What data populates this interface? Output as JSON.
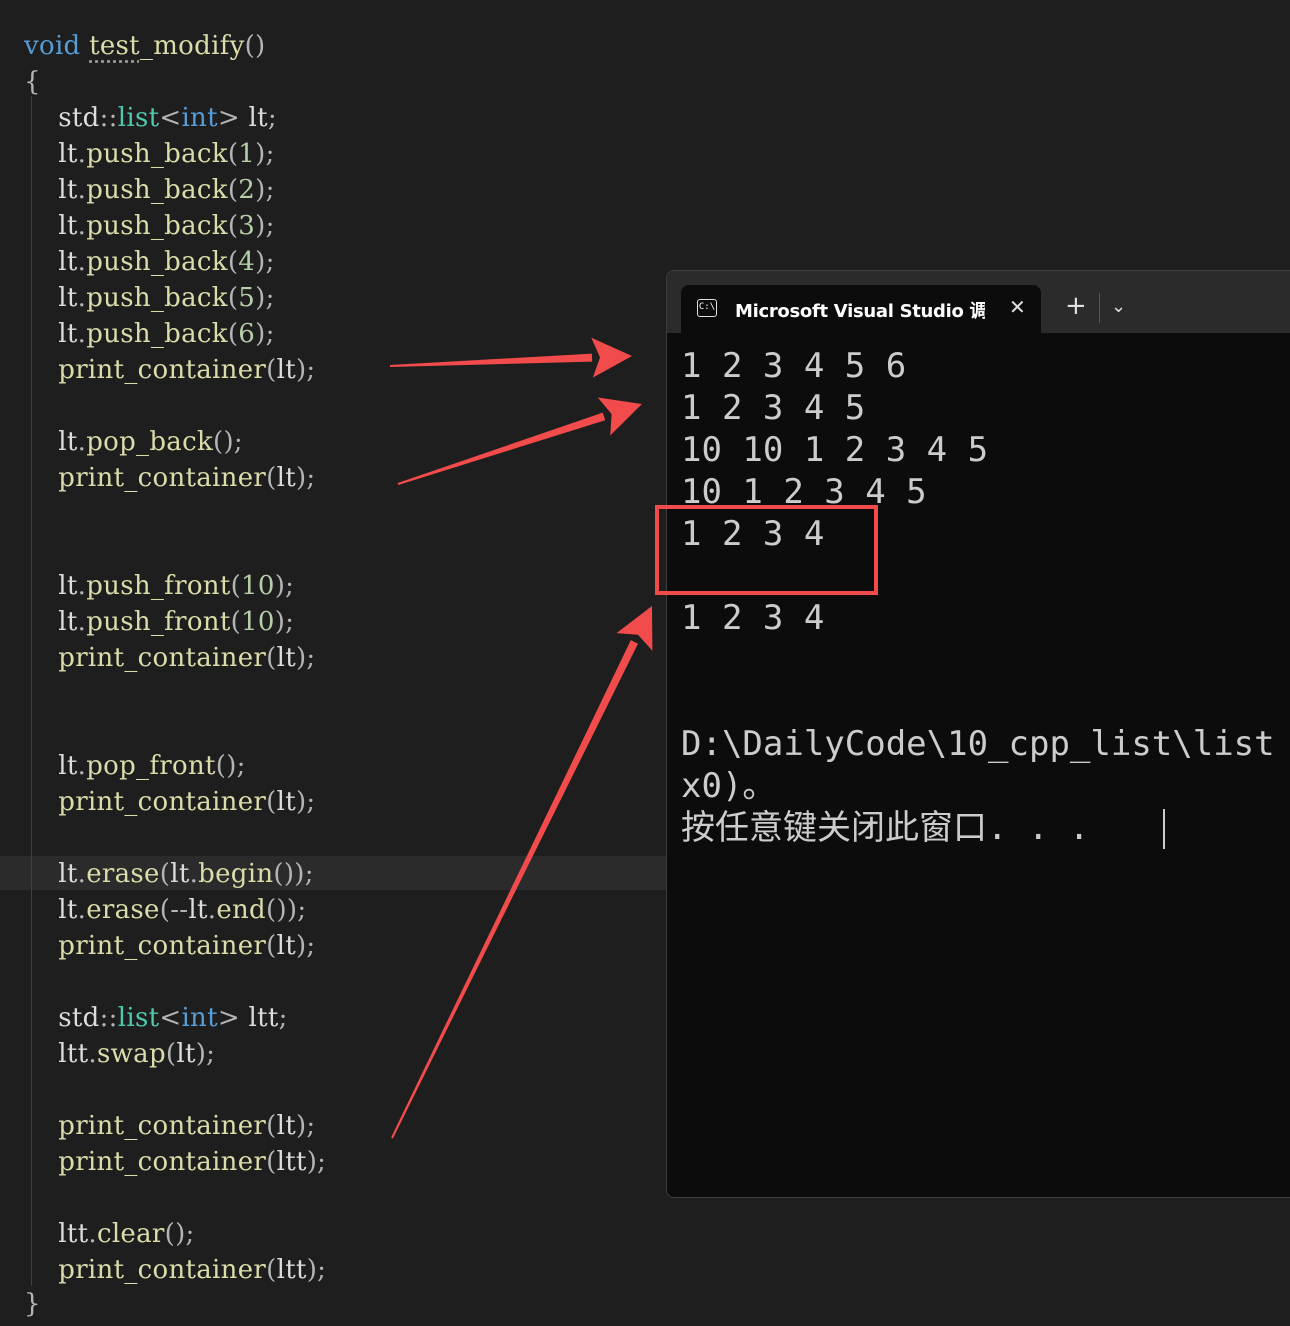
{
  "code": {
    "lines": [
      {
        "t": [
          {
            "c": "kw",
            "v": "void"
          },
          {
            "c": "id",
            "v": " "
          },
          {
            "c": "fn squig",
            "v": "test"
          },
          {
            "c": "fn",
            "v": "_modify"
          },
          {
            "c": "pu",
            "v": "()"
          }
        ]
      },
      {
        "t": [
          {
            "c": "pu",
            "v": "{"
          }
        ]
      },
      {
        "t": [
          {
            "c": "id",
            "v": "    std"
          },
          {
            "c": "pu",
            "v": "::"
          },
          {
            "c": "ty",
            "v": "list"
          },
          {
            "c": "pu",
            "v": "<"
          },
          {
            "c": "kw",
            "v": "int"
          },
          {
            "c": "pu",
            "v": ">"
          },
          {
            "c": "id",
            "v": " lt"
          },
          {
            "c": "pu",
            "v": ";"
          }
        ]
      },
      {
        "t": [
          {
            "c": "id",
            "v": "    lt"
          },
          {
            "c": "pu",
            "v": "."
          },
          {
            "c": "fn",
            "v": "push_back"
          },
          {
            "c": "pu",
            "v": "("
          },
          {
            "c": "nu",
            "v": "1"
          },
          {
            "c": "pu",
            "v": ");"
          }
        ]
      },
      {
        "t": [
          {
            "c": "id",
            "v": "    lt"
          },
          {
            "c": "pu",
            "v": "."
          },
          {
            "c": "fn",
            "v": "push_back"
          },
          {
            "c": "pu",
            "v": "("
          },
          {
            "c": "nu",
            "v": "2"
          },
          {
            "c": "pu",
            "v": ");"
          }
        ]
      },
      {
        "t": [
          {
            "c": "id",
            "v": "    lt"
          },
          {
            "c": "pu",
            "v": "."
          },
          {
            "c": "fn",
            "v": "push_back"
          },
          {
            "c": "pu",
            "v": "("
          },
          {
            "c": "nu",
            "v": "3"
          },
          {
            "c": "pu",
            "v": ");"
          }
        ]
      },
      {
        "t": [
          {
            "c": "id",
            "v": "    lt"
          },
          {
            "c": "pu",
            "v": "."
          },
          {
            "c": "fn",
            "v": "push_back"
          },
          {
            "c": "pu",
            "v": "("
          },
          {
            "c": "nu",
            "v": "4"
          },
          {
            "c": "pu",
            "v": ");"
          }
        ]
      },
      {
        "t": [
          {
            "c": "id",
            "v": "    lt"
          },
          {
            "c": "pu",
            "v": "."
          },
          {
            "c": "fn",
            "v": "push_back"
          },
          {
            "c": "pu",
            "v": "("
          },
          {
            "c": "nu",
            "v": "5"
          },
          {
            "c": "pu",
            "v": ");"
          }
        ]
      },
      {
        "t": [
          {
            "c": "id",
            "v": "    lt"
          },
          {
            "c": "pu",
            "v": "."
          },
          {
            "c": "fn",
            "v": "push_back"
          },
          {
            "c": "pu",
            "v": "("
          },
          {
            "c": "nu",
            "v": "6"
          },
          {
            "c": "pu",
            "v": ");"
          }
        ]
      },
      {
        "t": [
          {
            "c": "fn",
            "v": "    print_container"
          },
          {
            "c": "pu",
            "v": "("
          },
          {
            "c": "id",
            "v": "lt"
          },
          {
            "c": "pu",
            "v": ");"
          }
        ]
      },
      {
        "t": [
          {
            "c": "id",
            "v": "    lt"
          },
          {
            "c": "pu",
            "v": "."
          },
          {
            "c": "fn",
            "v": "pop_back"
          },
          {
            "c": "pu",
            "v": "();"
          }
        ]
      },
      {
        "t": [
          {
            "c": "fn",
            "v": "    print_container"
          },
          {
            "c": "pu",
            "v": "("
          },
          {
            "c": "id",
            "v": "lt"
          },
          {
            "c": "pu",
            "v": ");"
          }
        ]
      },
      {
        "t": [
          {
            "c": "id",
            "v": "    lt"
          },
          {
            "c": "pu",
            "v": "."
          },
          {
            "c": "fn",
            "v": "push_front"
          },
          {
            "c": "pu",
            "v": "("
          },
          {
            "c": "nu",
            "v": "10"
          },
          {
            "c": "pu",
            "v": ");"
          }
        ]
      },
      {
        "t": [
          {
            "c": "id",
            "v": "    lt"
          },
          {
            "c": "pu",
            "v": "."
          },
          {
            "c": "fn",
            "v": "push_front"
          },
          {
            "c": "pu",
            "v": "("
          },
          {
            "c": "nu",
            "v": "10"
          },
          {
            "c": "pu",
            "v": ");"
          }
        ]
      },
      {
        "t": [
          {
            "c": "fn",
            "v": "    print_container"
          },
          {
            "c": "pu",
            "v": "("
          },
          {
            "c": "id",
            "v": "lt"
          },
          {
            "c": "pu",
            "v": ");"
          }
        ]
      },
      {
        "t": [
          {
            "c": "id",
            "v": "    lt"
          },
          {
            "c": "pu",
            "v": "."
          },
          {
            "c": "fn",
            "v": "pop_front"
          },
          {
            "c": "pu",
            "v": "();"
          }
        ]
      },
      {
        "t": [
          {
            "c": "fn",
            "v": "    print_container"
          },
          {
            "c": "pu",
            "v": "("
          },
          {
            "c": "id",
            "v": "lt"
          },
          {
            "c": "pu",
            "v": ");"
          }
        ]
      },
      {
        "t": [
          {
            "c": "id",
            "v": "    lt"
          },
          {
            "c": "pu",
            "v": "."
          },
          {
            "c": "fn",
            "v": "erase"
          },
          {
            "c": "pu",
            "v": "("
          },
          {
            "c": "id",
            "v": "lt"
          },
          {
            "c": "pu",
            "v": "."
          },
          {
            "c": "fn",
            "v": "begin"
          },
          {
            "c": "pu",
            "v": "());"
          }
        ]
      },
      {
        "t": [
          {
            "c": "id",
            "v": "    lt"
          },
          {
            "c": "pu",
            "v": "."
          },
          {
            "c": "fn",
            "v": "erase"
          },
          {
            "c": "pu",
            "v": "(--"
          },
          {
            "c": "id",
            "v": "lt"
          },
          {
            "c": "pu",
            "v": "."
          },
          {
            "c": "fn",
            "v": "end"
          },
          {
            "c": "pu",
            "v": "());"
          }
        ]
      },
      {
        "t": [
          {
            "c": "fn",
            "v": "    print_container"
          },
          {
            "c": "pu",
            "v": "("
          },
          {
            "c": "id",
            "v": "lt"
          },
          {
            "c": "pu",
            "v": ");"
          }
        ]
      },
      {
        "t": [
          {
            "c": "id",
            "v": "    std"
          },
          {
            "c": "pu",
            "v": "::"
          },
          {
            "c": "ty",
            "v": "list"
          },
          {
            "c": "pu",
            "v": "<"
          },
          {
            "c": "kw",
            "v": "int"
          },
          {
            "c": "pu",
            "v": ">"
          },
          {
            "c": "id",
            "v": " ltt"
          },
          {
            "c": "pu",
            "v": ";"
          }
        ]
      },
      {
        "t": [
          {
            "c": "id",
            "v": "    ltt"
          },
          {
            "c": "pu",
            "v": "."
          },
          {
            "c": "fn",
            "v": "swap"
          },
          {
            "c": "pu",
            "v": "("
          },
          {
            "c": "id",
            "v": "lt"
          },
          {
            "c": "pu",
            "v": ");"
          }
        ]
      },
      {
        "t": [
          {
            "c": "fn",
            "v": "    print_container"
          },
          {
            "c": "pu",
            "v": "("
          },
          {
            "c": "id",
            "v": "lt"
          },
          {
            "c": "pu",
            "v": ");"
          }
        ]
      },
      {
        "t": [
          {
            "c": "fn",
            "v": "    print_container"
          },
          {
            "c": "pu",
            "v": "("
          },
          {
            "c": "id",
            "v": "ltt"
          },
          {
            "c": "pu",
            "v": ");"
          }
        ]
      },
      {
        "t": [
          {
            "c": "id",
            "v": "    ltt"
          },
          {
            "c": "pu",
            "v": "."
          },
          {
            "c": "fn",
            "v": "clear"
          },
          {
            "c": "pu",
            "v": "();"
          }
        ]
      },
      {
        "t": [
          {
            "c": "fn",
            "v": "    print_container"
          },
          {
            "c": "pu",
            "v": "("
          },
          {
            "c": "id",
            "v": "ltt"
          },
          {
            "c": "pu",
            "v": ");"
          }
        ]
      },
      {
        "t": [
          {
            "c": "pu",
            "v": "}"
          }
        ]
      }
    ]
  },
  "terminal": {
    "tab_title": "Microsoft Visual Studio 调试控制台",
    "tab_icon_glyph": "C:\\",
    "close_glyph": "✕",
    "new_tab_glyph": "+",
    "dropdown_glyph": "⌄",
    "output": [
      "1 2 3 4 5 6",
      "1 2 3 4 5",
      "10 10 1 2 3 4 5",
      "10 1 2 3 4 5",
      "1 2 3 4",
      "",
      "1 2 3 4",
      "",
      "",
      "D:\\DailyCode\\10_cpp_list\\list",
      "x0)。",
      "按任意键关闭此窗口. . ."
    ]
  },
  "annotations": {
    "arrow_color": "#f24b4b",
    "box_color": "#f24b4b"
  }
}
